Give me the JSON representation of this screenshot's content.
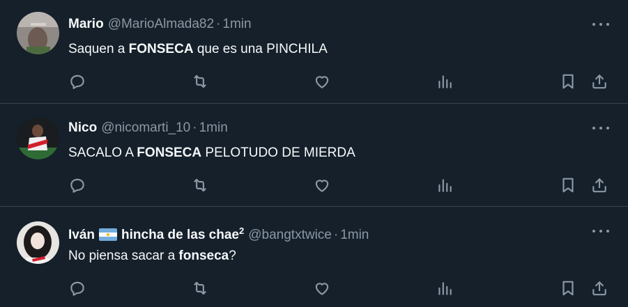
{
  "tweets": [
    {
      "name": "Mario",
      "handle": "@MarioAlmada82",
      "separator": "·",
      "time": "1min",
      "text_before": "Saquen a ",
      "text_bold": "FONSECA",
      "text_after": " que es una PINCHILA"
    },
    {
      "name": "Nico",
      "handle": "@nicomarti_10",
      "separator": "·",
      "time": "1min",
      "text_before": "SACALO A ",
      "text_bold": "FONSECA",
      "text_after": " PELOTUDO DE MIERDA"
    },
    {
      "name": "Iván",
      "name_suffix": "hincha de las chae",
      "name_sup": "2",
      "handle": "@bangtxtwice",
      "separator": "·",
      "time": "1min",
      "text_before": "No piensa sacar a ",
      "text_bold": "fonseca",
      "text_after": "?"
    }
  ],
  "icons": [
    "reply-icon",
    "retweet-icon",
    "like-icon",
    "views-icon",
    "bookmark-icon",
    "share-icon",
    "more-icon"
  ],
  "colors": {
    "background": "#15202b",
    "text": "#f7f9f9",
    "secondary": "#8b98a5",
    "divider": "#38444d"
  }
}
